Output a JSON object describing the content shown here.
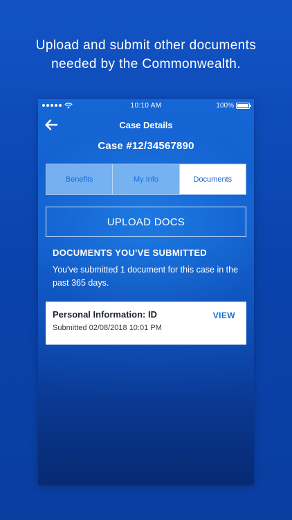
{
  "headline": {
    "line1": "Upload and submit other documents",
    "line2": "needed by the Commonwealth."
  },
  "status_bar": {
    "time": "10:10 AM",
    "battery": "100%"
  },
  "nav": {
    "title": "Case Details",
    "back_icon": "back-arrow-icon"
  },
  "case": {
    "number": "Case #12/34567890"
  },
  "tabs": [
    {
      "label": "Benefits",
      "active": false
    },
    {
      "label": "My Info",
      "active": false
    },
    {
      "label": "Documents",
      "active": true
    }
  ],
  "upload": {
    "label": "UPLOAD DOCS"
  },
  "submitted": {
    "title": "DOCUMENTS YOU'VE SUBMITTED",
    "description": "You've submitted 1 document for this case in the past 365 days."
  },
  "documents": [
    {
      "name": "Personal Information: ID",
      "submitted": "Submitted 02/08/2018 10:01 PM",
      "action": "VIEW"
    }
  ],
  "colors": {
    "background": "#0d47b0",
    "accent": "#1a6fd8",
    "card": "#ffffff"
  }
}
